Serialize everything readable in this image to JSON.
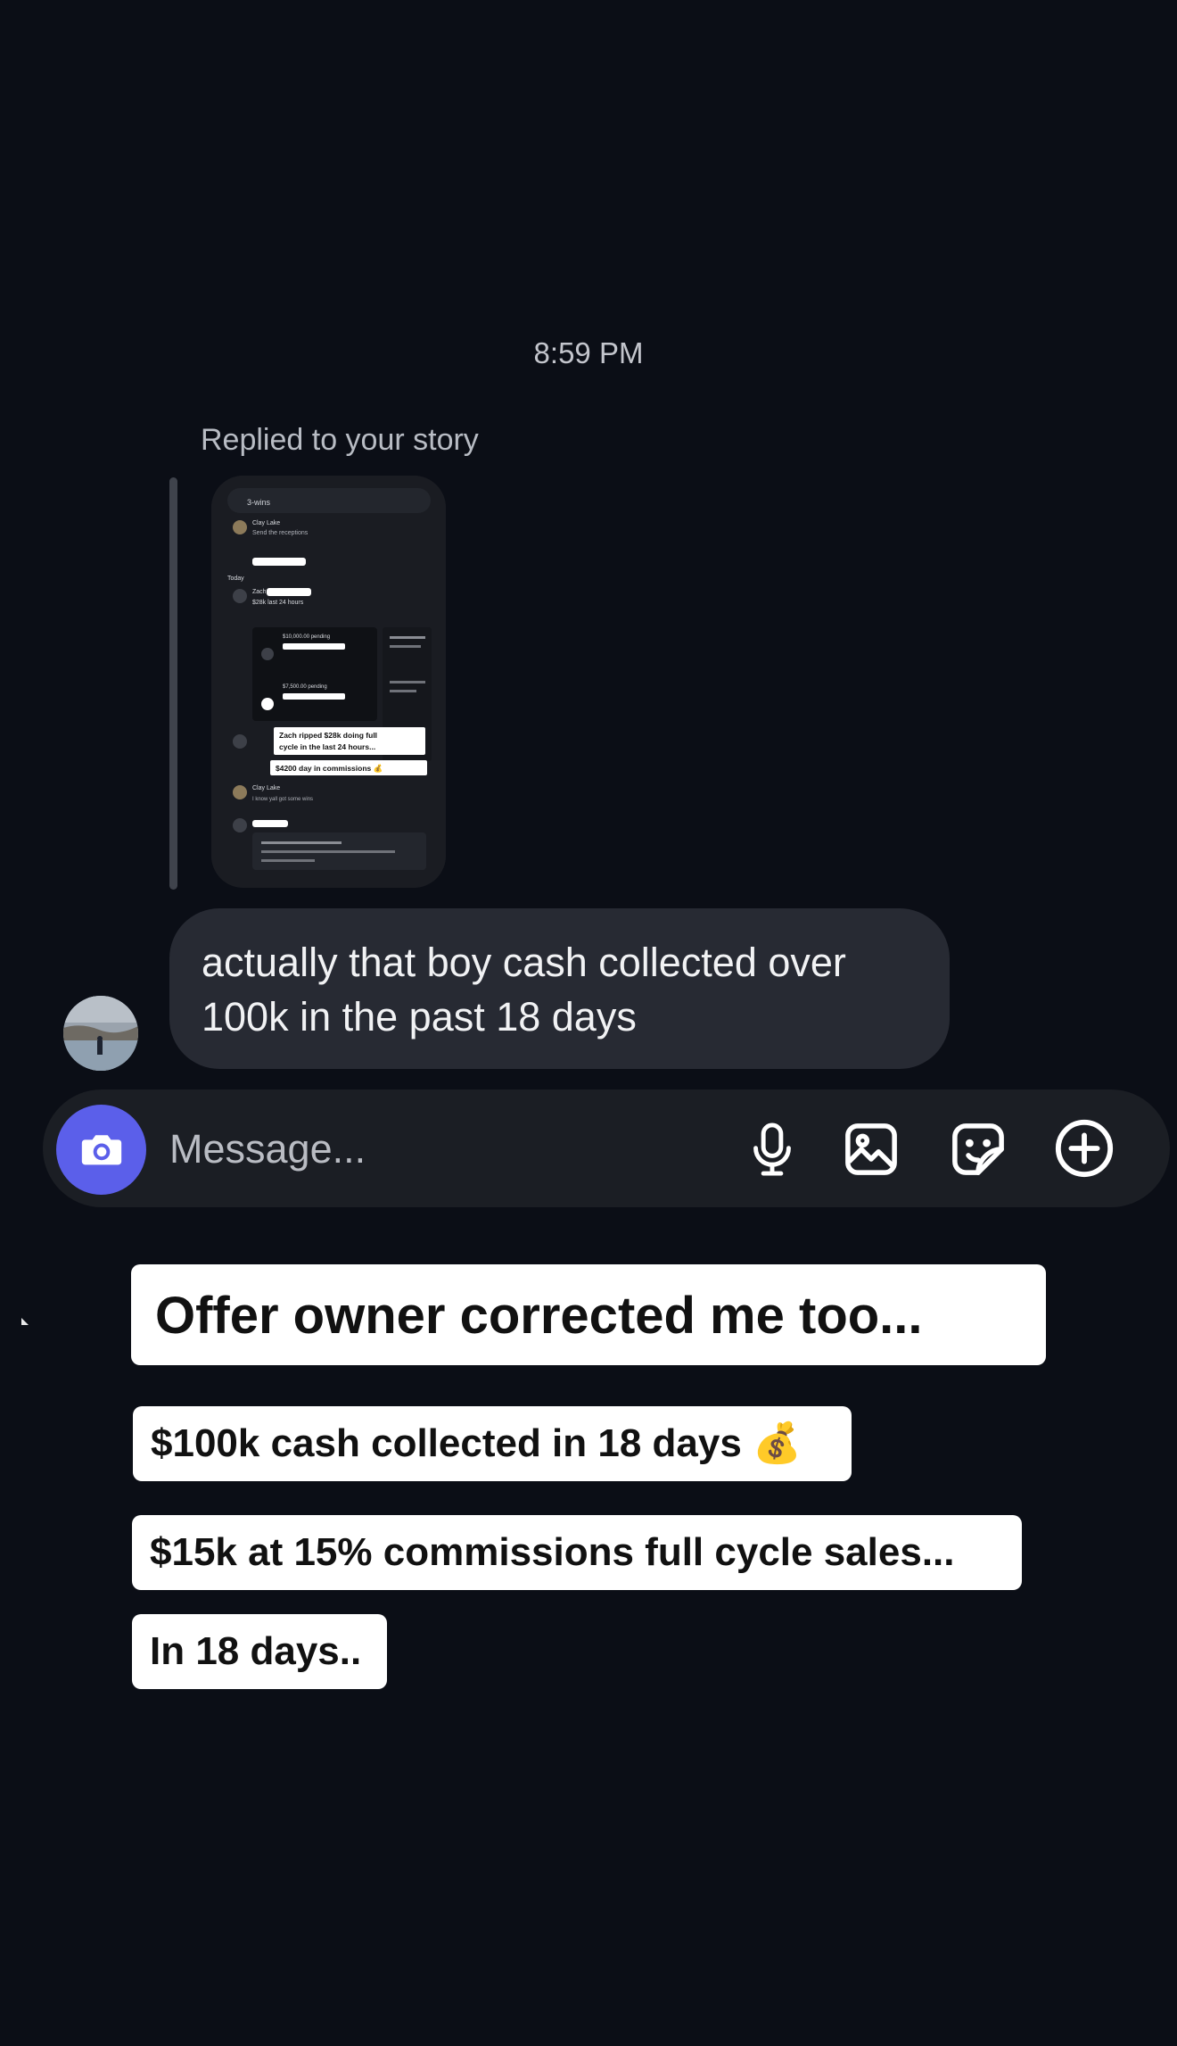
{
  "conversation": {
    "timestamp": "8:59 PM",
    "reply_label": "Replied to your story",
    "message_text": "actually that boy cash collected over 100k in the past 18 days"
  },
  "story_preview": {
    "header_channel": "3-wins",
    "day_label": "Today",
    "sender_1": "Clay Lake",
    "sender_1_text": "Send the receptions",
    "sender_2": "Zach",
    "sender_2_text": "$28k last 24 hours",
    "amount_1": "$10,000.00 pending",
    "amount_2": "$7,500.00 pending",
    "overlay_line_1": "Zach ripped $28k doing full",
    "overlay_line_2": "cycle in the last 24 hours...",
    "overlay_line_3": "$4200 day in commissions 💰",
    "sender_3": "Clay Lake",
    "sender_3_text": "I know yall got some wins"
  },
  "composer": {
    "placeholder": "Message...",
    "icons": [
      "camera-icon",
      "microphone-icon",
      "gallery-icon",
      "sticker-icon",
      "plus-icon"
    ],
    "accent_color": "#5b5fea"
  },
  "captions": [
    "Offer owner corrected me too...",
    "$100k cash collected in 18 days 💰",
    "$15k at 15% commissions full cycle sales...",
    "In 18 days.."
  ]
}
